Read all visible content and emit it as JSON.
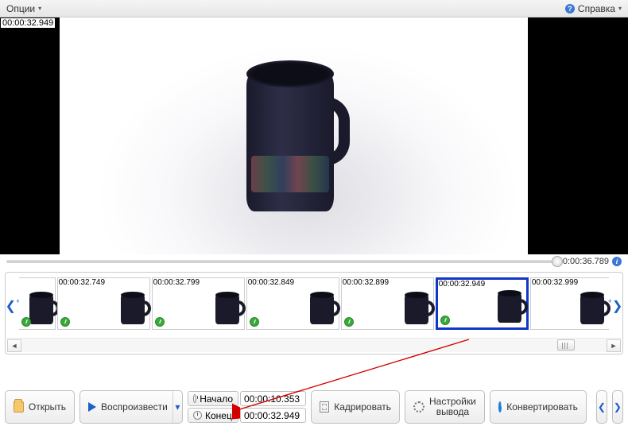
{
  "topbar": {
    "options": "Опции",
    "help": "Справка"
  },
  "preview": {
    "timestamp": "00:00:32.949",
    "duration": "0:00:36.789"
  },
  "thumbs": [
    {
      "t": "00:00:32.749"
    },
    {
      "t": "00:00:32.799"
    },
    {
      "t": "00:00:32.849"
    },
    {
      "t": "00:00:32.899"
    },
    {
      "t": "00:00:32.949"
    },
    {
      "t": "00:00:32.999"
    }
  ],
  "selected_thumb_index": 4,
  "bottom": {
    "open": "Открыть",
    "play": "Воспроизвести",
    "mark_in_label": "Начало",
    "mark_in_time": "00:00:10.353",
    "mark_out_label": "Конец",
    "mark_out_time": "00:00:32.949",
    "crop": "Кадрировать",
    "settings_l1": "Настройки",
    "settings_l2": "вывода",
    "convert": "Конвертировать"
  }
}
